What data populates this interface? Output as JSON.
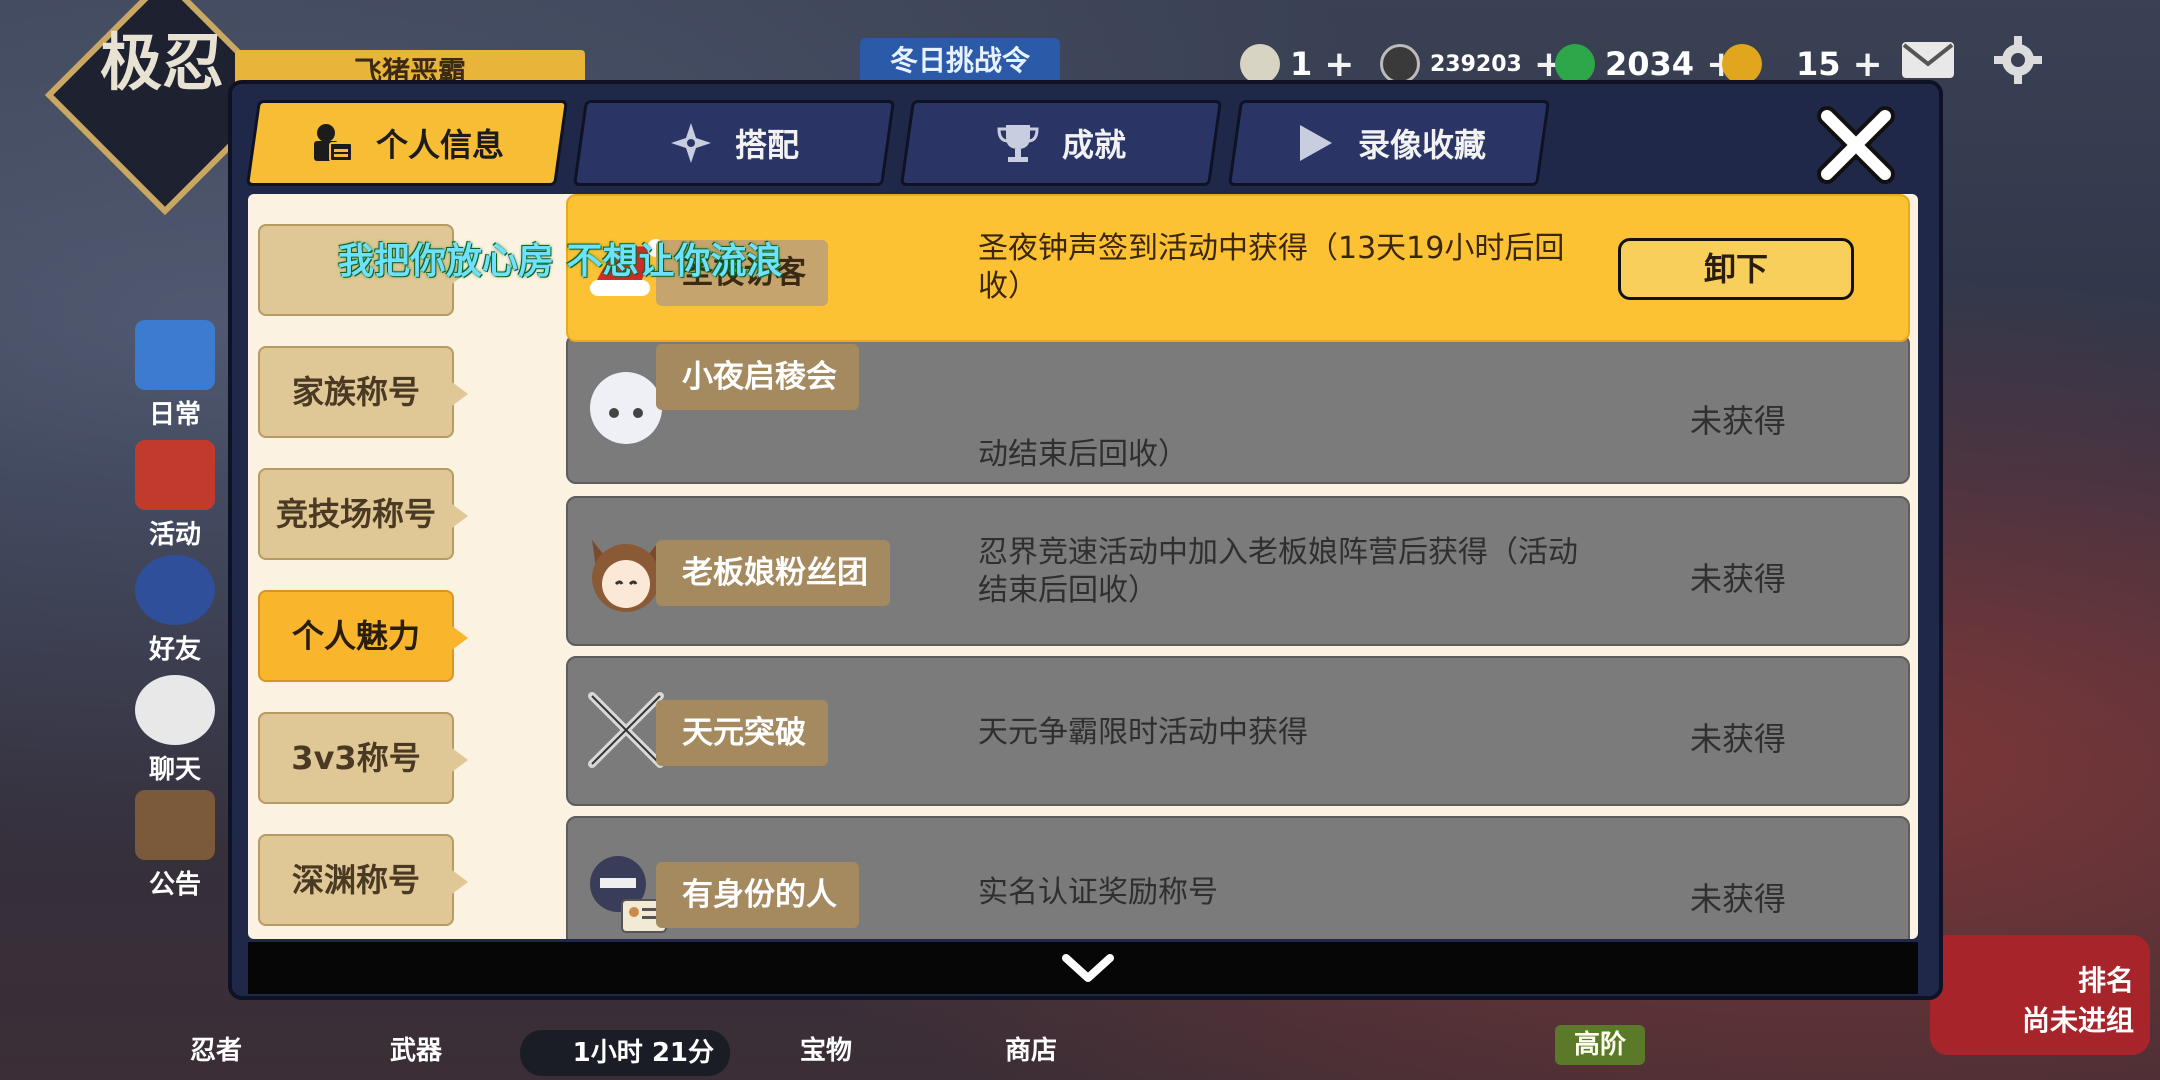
{
  "hud": {
    "logo_text": "极忍",
    "player_name": "飞猪恶霸",
    "winter_event": "冬日挑战令",
    "currency": [
      {
        "icon": "rice-ball-icon",
        "value": "1",
        "plus": "+"
      },
      {
        "icon": "coin-icon",
        "value": "239203",
        "plus": "+"
      },
      {
        "icon": "green-gem-icon",
        "value": "2034",
        "plus": "+"
      },
      {
        "icon": "ticket-icon",
        "value": "15",
        "plus": "+"
      }
    ],
    "mail_icon": "mail-icon",
    "settings_icon": "gear-icon"
  },
  "side_nav": [
    {
      "label": "日常",
      "icon": "gift-box-icon"
    },
    {
      "label": "活动",
      "icon": "torii-gate-icon"
    },
    {
      "label": "好友",
      "icon": "ninja-face-icon"
    },
    {
      "label": "聊天",
      "icon": "chat-bubble-icon"
    },
    {
      "label": "公告",
      "icon": "notice-board-icon"
    }
  ],
  "bottom_nav": [
    {
      "label": "忍者"
    },
    {
      "label": "武器"
    },
    {
      "label": "宝物"
    },
    {
      "label": "商店"
    }
  ],
  "timer": "1小时 21分",
  "tier_badge": "高阶",
  "rank_panel": {
    "line1": "排名",
    "line2": "尚未进组"
  },
  "modal": {
    "tabs": [
      {
        "label": "个人信息",
        "icon": "profile-icon",
        "active": true
      },
      {
        "label": "搭配",
        "icon": "shuriken-icon",
        "active": false
      },
      {
        "label": "成就",
        "icon": "trophy-icon",
        "active": false
      },
      {
        "label": "录像收藏",
        "icon": "play-icon",
        "active": false
      }
    ],
    "close_icon": "close-icon",
    "categories": [
      {
        "label": "",
        "active": false
      },
      {
        "label": "家族称号",
        "active": false
      },
      {
        "label": "竞技场称号",
        "active": false
      },
      {
        "label": "个人魅力",
        "active": true
      },
      {
        "label": "3v3称号",
        "active": false
      },
      {
        "label": "深渊称号",
        "active": false
      }
    ],
    "caption_overlay": "我把你放心房 不想让你流浪",
    "titles": [
      {
        "name": "圣夜访客",
        "desc": "圣夜钟声签到活动中获得（13天19小时后回收）",
        "status": "",
        "action": "卸下",
        "highlight": true,
        "avatar": "santa-hat-icon"
      },
      {
        "name": "小夜启稜会",
        "desc": "动结束后回收）",
        "status": "未获得",
        "highlight": false,
        "avatar": "white-hair-ninja-icon"
      },
      {
        "name": "老板娘粉丝团",
        "desc": "忍界竞速活动中加入老板娘阵营后获得（活动结束后回收）",
        "status": "未获得",
        "highlight": false,
        "avatar": "cat-ear-girl-icon"
      },
      {
        "name": "天元突破",
        "desc": "天元争霸限时活动中获得",
        "status": "未获得",
        "highlight": false,
        "avatar": "crossed-swords-icon"
      },
      {
        "name": "有身份的人",
        "desc": "实名认证奖励称号",
        "status": "未获得",
        "highlight": false,
        "avatar": "id-card-ninja-icon"
      }
    ],
    "scroll_icon": "chevron-down-icon"
  },
  "colors": {
    "accent": "#f9b62d",
    "panel": "#20284a",
    "content_bg": "#fbf2e2",
    "row_gray": "#7b7b7b"
  }
}
